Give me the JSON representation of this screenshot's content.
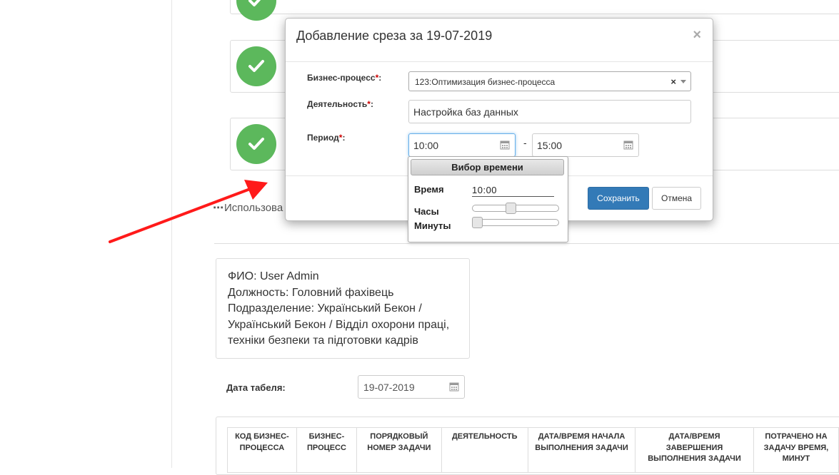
{
  "background_cards": {
    "check_icon": "check-circle-icon",
    "accent": "#5cb85c"
  },
  "usage_text": "Использова",
  "employee": {
    "fio": "ФИО: User Admin",
    "position": "Должность: Головний фахівець",
    "division_line1": "Подразделение: Український Бекон /",
    "division_line2": "Український Бекон / Відділ охорони праці,",
    "division_line3": "техніки безпеки та підготовки кадрів"
  },
  "timesheet": {
    "label": "Дата табеля:",
    "value": "19-07-2019",
    "icon": "calendar-icon"
  },
  "table": {
    "headers": [
      "КОД БИЗНЕС-ПРОЦЕССА",
      "БИЗНЕС-ПРОЦЕСС",
      "ПОРЯДКОВЫЙ НОМЕР ЗАДАЧИ",
      "ДЕЯТЕЛЬНОСТЬ",
      "ДАТА/ВРЕМЯ НАЧАЛА ВЫПОЛНЕНИЯ ЗАДАЧИ",
      "ДАТА/ВРЕМЯ ЗАВЕРШЕНИЯ ВЫПОЛНЕНИЯ ЗАДАЧИ",
      "ПОТРАЧЕНО НА ЗАДАЧУ ВРЕМЯ, МИНУТ"
    ]
  },
  "modal": {
    "title": "Добавление среза за 19-07-2019",
    "close": "×",
    "business_process_label": "Бизнес-процесс",
    "business_process_value": "123:Оптимизация бизнес-процесса",
    "clear": "×",
    "activity_label": "Деятельность",
    "activity_value": "Настройка баз данных",
    "period_label": "Период",
    "required_mark": "*",
    "colon": ":",
    "period_from": "10:00",
    "period_to": "15:00",
    "period_dash": "-",
    "save": "Сохранить",
    "cancel": "Отмена",
    "primary_color": "#337ab7"
  },
  "time_picker": {
    "title": "Вибор времени",
    "time_label": "Время",
    "time_value": "10:00",
    "hours_label": "Часы",
    "minutes_label": "Минуты",
    "hours_level": 0.435,
    "minutes_level": 0.0
  },
  "annotation": {
    "arrow_color": "#ff1a1a"
  }
}
